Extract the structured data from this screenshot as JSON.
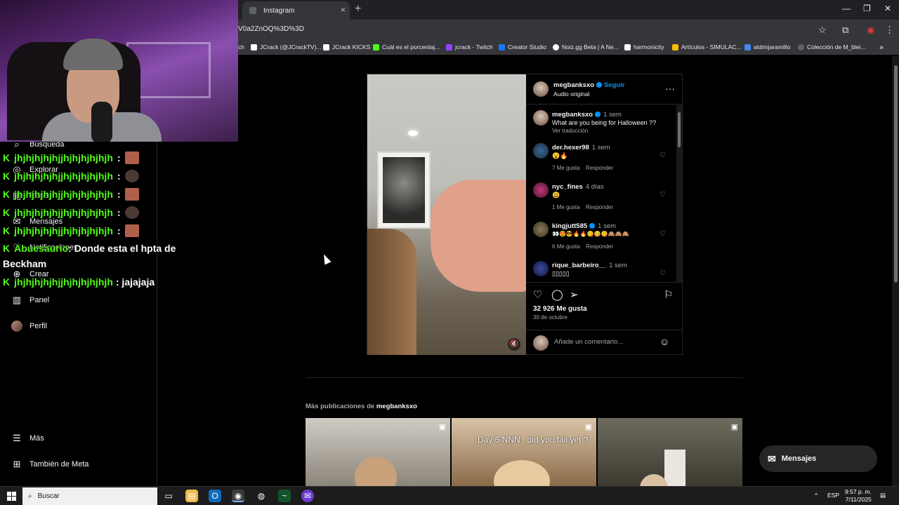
{
  "browser": {
    "tab_title": "Instagram",
    "tab_close": "×",
    "new_tab": "+",
    "url": "V0a2ZnOQ%3D%3D",
    "bookmarks_prefix": "ch",
    "bookmarks": [
      {
        "label": "JCrack (@JCrackTV)...",
        "color": "#ffffff"
      },
      {
        "label": "JCrack KICKS",
        "color": "#ffffff"
      },
      {
        "label": "Cuál es el porcentaj...",
        "color": "#53fc18"
      },
      {
        "label": "jcrack - Twitch",
        "color": "#9146ff"
      },
      {
        "label": "Creator Studio",
        "color": "#1877f2"
      },
      {
        "label": "Noiz.gg Beta | A Ne...",
        "color": "#ffffff"
      },
      {
        "label": "harmonicity",
        "color": "#ffffff"
      },
      {
        "label": "Artículos - SIMULAC...",
        "color": "#fbbc04"
      },
      {
        "label": "aldrinjaramillo",
        "color": "#4285f4"
      },
      {
        "label": "Colección de M_blei...",
        "color": "#5f6368"
      }
    ]
  },
  "nav": {
    "items": [
      {
        "label": "Búsqueda",
        "icon": "search-icon"
      },
      {
        "label": "Explorar",
        "icon": "compass-icon"
      },
      {
        "label": "Reels",
        "icon": "reels-icon"
      },
      {
        "label": "Mensajes",
        "icon": "messenger-icon"
      },
      {
        "label": "Notificaciones",
        "icon": "heart-icon"
      },
      {
        "label": "Crear",
        "icon": "plus-icon"
      },
      {
        "label": "Panel",
        "icon": "chart-icon"
      },
      {
        "label": "Perfil",
        "icon": "avatar"
      }
    ],
    "more": "Más",
    "meta": "También de Meta"
  },
  "chat": {
    "lines": [
      {
        "user": "jhjhjhjhjhjjhjhjhjhjhjh",
        "msg": ":",
        "emote": "#b0604a"
      },
      {
        "user": "jhjhjhjhjhjjhjhjhjhjhjh",
        "msg": ":",
        "emote": "#4a3a35"
      },
      {
        "user": "jhjhjhjhjhjjhjhjhjhjhjh",
        "msg": ":",
        "emote": "#b0604a"
      },
      {
        "user": "jhjhjhjhjhjjhjhjhjhjhjh",
        "msg": ":",
        "emote": "#4a3a35"
      },
      {
        "user": "jhjhjhjhjhjjhjhjhjhjhjh",
        "msg": ":",
        "emote": "#b0604a"
      }
    ],
    "long_user": "Abuesaurio",
    "long_msg_1": ": Donde esta el hpta de",
    "long_msg_2": "Beckham",
    "last_user": "jhjhjhjhjhjjhjhjhjhjhjh",
    "last_msg": ": jajajaja"
  },
  "post": {
    "author": "megbanksxo",
    "follow": "Seguir",
    "audio": "Audio original",
    "caption_user": "megbanksxo",
    "caption_time": "1 sem",
    "caption": "What are you being for Halloween ??",
    "translate": "Ver traducción",
    "comments": [
      {
        "user": "der.hexer98",
        "time": "1 sem",
        "text": "😮🔥",
        "likes": "7 Me gusta",
        "reply": "Responder"
      },
      {
        "user": "nyc_fines",
        "time": "4 días",
        "text": "😃",
        "likes": "1 Me gusta",
        "reply": "Responder"
      },
      {
        "user": "kingjutt585",
        "time": "1 sem",
        "text": "👀😍😎🔥🔥😋😋😋🙈🙈🙈",
        "likes": "6 Me gusta",
        "reply": "Responder"
      },
      {
        "user": "rique_barbeiro__",
        "time": "1 sem",
        "text": "▯▯▯▯▯",
        "likes": "",
        "reply": ""
      }
    ],
    "likes": "32 926 Me gusta",
    "date": "30 de octubre",
    "comment_placeholder": "Añade un comentario...",
    "mute": "🔇"
  },
  "more": {
    "label": "Más publicaciones de",
    "user": "megbanksxo",
    "thumb2_caption": "Day 6 NNN.. did you fail yet ?"
  },
  "messages_button": "Mensajes",
  "taskbar": {
    "search": "Buscar",
    "lang": "ESP",
    "time": "9:57 p. m.",
    "date": "7/11/2025"
  }
}
